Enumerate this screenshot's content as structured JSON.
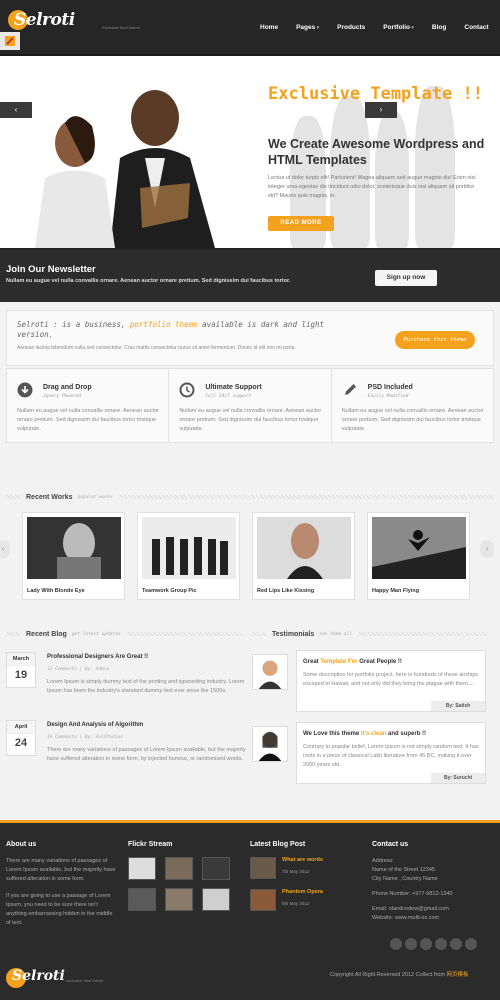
{
  "header": {
    "logo": "Selroti",
    "tagline": "Exclusive html theme",
    "nav": [
      "Home",
      "Pages",
      "Products",
      "Portfolio",
      "Blog",
      "Contact"
    ]
  },
  "hero": {
    "title": "Exclusive Template !!",
    "subtitle": "We Create Awesome Wordpress and HTML Templates",
    "body": "Lectus ut dolor turpis elit! Parturient! Magna aliquam sed augue magnis dis! Enim nisi integer urna egestas dis tincidunt odio dolor, scelerisque duis nisi aliquam sit porttitor elit? Mauris quis magnis, in.",
    "button": "READ MORE",
    "prev_arrow": "‹",
    "next_arrow": "›"
  },
  "newsletter": {
    "title": "Join Our Newsletter",
    "text": "Nullam eu augue vel nulla convallis ornare. Aenean auctor ornare pretium. Sed dignissim dui faucibus tortor.",
    "button": "Sign up now"
  },
  "intro": {
    "title_a": "Selroti : is a business, ",
    "title_hl": "portfolio theme",
    "title_b": " available is dark and light version.",
    "body": "Aenean lacinia bibendum nulla sed consectetur. Cras mattis consectetur purus sit amet fermentum. Donec id elit non mi porta.",
    "button": "Purchase this theme"
  },
  "features": [
    {
      "title": "Drag and Drop",
      "sub": "Jquery Powered",
      "icon": "download-circle-icon",
      "body": "Nullam eu augue vel nulla convallis ornare. Aenean auctor ornare pretium. Sed dignissim dui faucibus tortor tristique vulputate."
    },
    {
      "title": "Ultimate Support",
      "sub": "Full 24/7 support",
      "icon": "history-clock-icon",
      "body": "Nullam eu augue vel nulla convallis ornare. Aenean auctor ornare pretium. Sed dignissim dui faucibus tortor tristique vulputate."
    },
    {
      "title": "PSD Included",
      "sub": "Easily Modified",
      "icon": "pencil-icon",
      "body": "Nullam eu augue vel nulla convallis ornare. Aenean auctor ornare pretium. Sed dignissim dui faucibus tortor tristique vulputate."
    }
  ],
  "recent_works": {
    "title": "Recent Works",
    "sub": "popular works",
    "items": [
      "Lady With Blonde Eye",
      "Teamwork Group Pic",
      "Red Lips Like Kissing",
      "Happy Man Flying"
    ],
    "left": "‹",
    "right": "›"
  },
  "recent_blog": {
    "title": "Recent Blog",
    "sub": "get latest updates",
    "posts": [
      {
        "month": "March",
        "day": "19",
        "title": "Professional Designers Are Great !!",
        "meta": "12 Comments  |  By: Admin",
        "body": "Lorem Ipsum is simply dummy text of the printing and typesetting industry. Lorem Ipsum has been the industry's standard dummy text ever since the 1500s."
      },
      {
        "month": "April",
        "day": "24",
        "title": "Design And Analysis of Algorithm",
        "meta": "16 Comments  |  By: AnlStudios",
        "body": "There are many variations of passages of Lorem Ipsum available, but the majority have suffered alteration in some form, by injected humour, or randomised words."
      }
    ]
  },
  "testimonials": {
    "title": "Testimonials",
    "sub": "see them all",
    "items": [
      {
        "title_a": "Great ",
        "title_hl": "Template For",
        "title_b": " Great People !!",
        "body": "Some description for portfolio project, here is hundreds of these airships escaped to Hawaii, and not only did they bring the plague with them....",
        "by": "By: Satish"
      },
      {
        "title_a": "We Love this theme ",
        "title_hl": "it's clean",
        "title_b": " and superb !!",
        "body": "Contrary to popular belief, Lorem Ipsum is not simply random text. It has roots in a piece of classical Latin literature from 45 BC, making it over 2000 years old.",
        "by": "By: Suruchi"
      }
    ]
  },
  "footer": {
    "about_title": "About us",
    "about_p1": "There are many variations of passages of Lorem Ipsum available, but the majority have suffered alteration in some form.",
    "about_p2": "If you are going to use a passage of Lorem Ipsum, you need to be sure there isn't anything embarrassing hidden in the middle of text.",
    "flickr_title": "Flickr Stream",
    "latest_title": "Latest Blog Post",
    "latest": [
      {
        "title": "What are words",
        "date": "7th May 2012"
      },
      {
        "title": "Phantom Opera",
        "date": "9th May 2012"
      }
    ],
    "contact_title": "Contact us",
    "contact_address_label": "Address:",
    "contact_street": "Name of the Street 12345",
    "contact_city": "City Name , Country Name",
    "contact_phone": "Phone Number: +977-9812-1340",
    "contact_email": "Email: nlandcodew@gmail.com",
    "contact_website": "Website: www.multi-ox.com",
    "logo": "Selroti",
    "tagline": "exclusive html theme",
    "copyright_a": "Copyright All Right Reversed 2012",
    "copyright_b": "Collect from ",
    "copyright_hl": "网页模板"
  },
  "colors": {
    "accent": "#f4a21d",
    "dark": "#2b2b2b"
  }
}
